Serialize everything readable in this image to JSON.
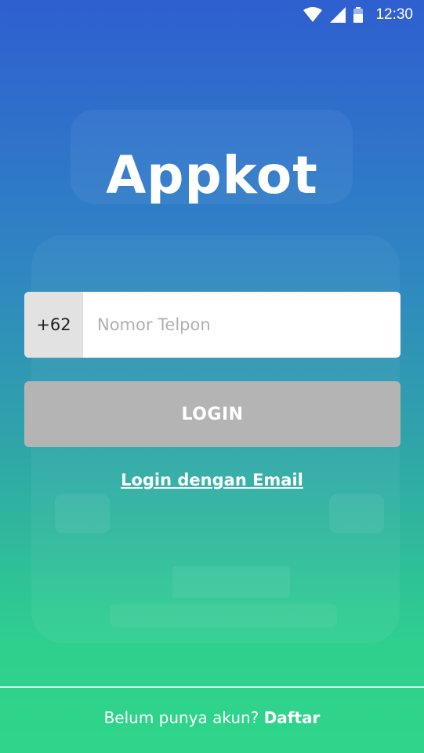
{
  "status_bar": {
    "time": "12:30",
    "icons": [
      "wifi-icon",
      "signal-icon",
      "battery-icon"
    ]
  },
  "app": {
    "title": "Appkot"
  },
  "phone_login": {
    "country_code": "+62",
    "phone_placeholder": "Nomor Telpon",
    "phone_value": ""
  },
  "login_button": {
    "label": "LOGIN"
  },
  "email_login": {
    "label": "Login dengan Email"
  },
  "signup": {
    "prompt": "Belum punya akun?",
    "link_label": "Daftar"
  },
  "colors": {
    "gradient_top": "#2f5fd0",
    "gradient_bottom": "#2fd68a",
    "button_disabled": "#b4b4b4",
    "country_code_bg": "#e2e2e2"
  }
}
